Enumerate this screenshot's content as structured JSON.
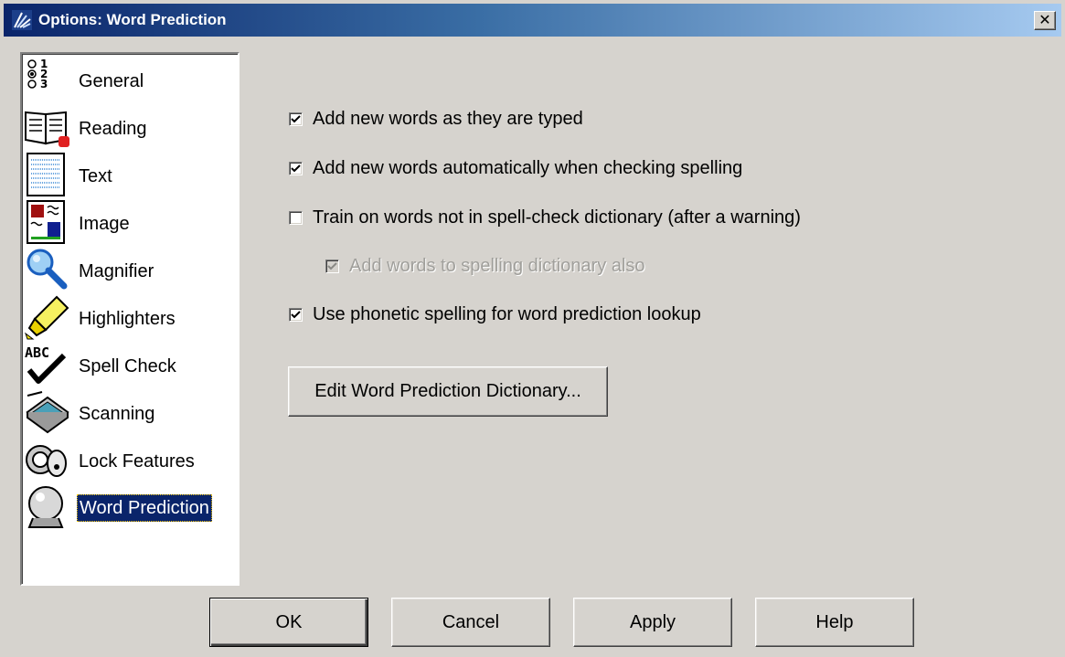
{
  "window": {
    "title": "Options: Word Prediction"
  },
  "sidebar": {
    "items": [
      {
        "label": "General",
        "icon": "general-options-icon"
      },
      {
        "label": "Reading",
        "icon": "book-icon"
      },
      {
        "label": "Text",
        "icon": "text-page-icon"
      },
      {
        "label": "Image",
        "icon": "image-page-icon"
      },
      {
        "label": "Magnifier",
        "icon": "magnifier-icon"
      },
      {
        "label": "Highlighters",
        "icon": "highlighter-icon"
      },
      {
        "label": "Spell Check",
        "icon": "spell-check-icon"
      },
      {
        "label": "Scanning",
        "icon": "scanner-icon"
      },
      {
        "label": "Lock Features",
        "icon": "lock-features-icon"
      },
      {
        "label": "Word Prediction",
        "icon": "crystal-ball-icon"
      }
    ],
    "selected": "Word Prediction"
  },
  "options": [
    {
      "label": "Add new words as they are typed",
      "checked": true,
      "enabled": true,
      "underline": "t"
    },
    {
      "label": "Add new words automatically when checking spelling",
      "checked": true,
      "enabled": true,
      "underline": "s"
    },
    {
      "label": "Train on words not in spell-check dictionary (after a warning)",
      "checked": false,
      "enabled": true,
      "underline": "n"
    },
    {
      "label": "Add words to spelling dictionary also",
      "checked": true,
      "enabled": false,
      "underline": "w"
    },
    {
      "label": "Use phonetic spelling for word prediction lookup",
      "checked": true,
      "enabled": true,
      "underline": "p"
    }
  ],
  "edit_dictionary_button": {
    "label": "Edit Word Prediction Dictionary..."
  },
  "buttons": {
    "ok": "OK",
    "cancel": "Cancel",
    "apply": "Apply",
    "help": "Help"
  },
  "colors": {
    "titlebar_start": "#0a246a",
    "titlebar_end": "#a6caf0",
    "dialog_bg": "#d6d3ce",
    "selection_bg": "#0a246a"
  }
}
